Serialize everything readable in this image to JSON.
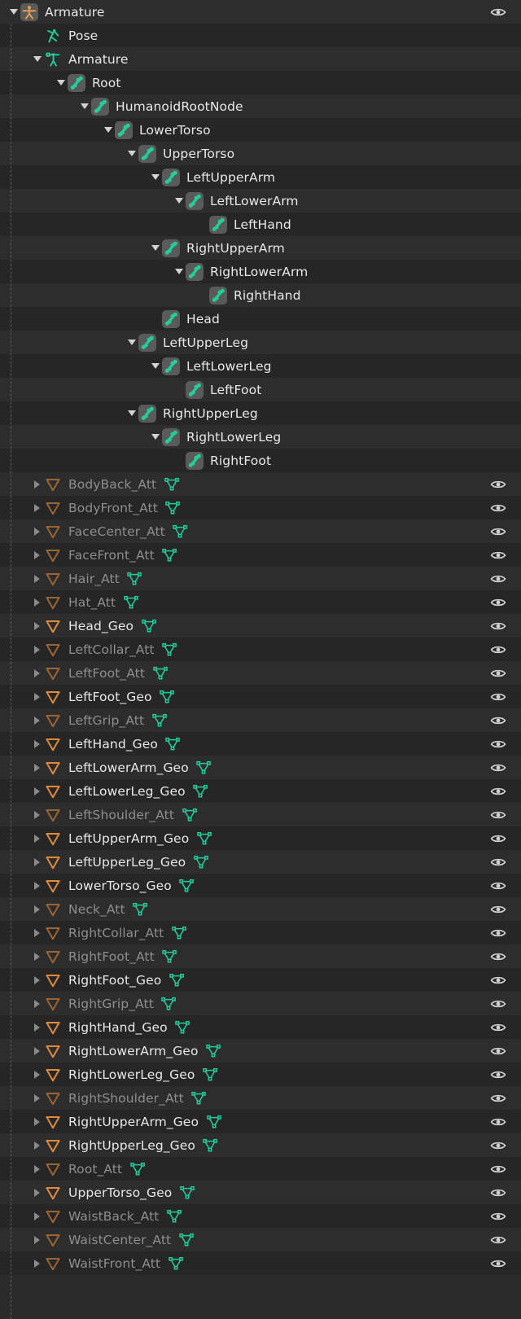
{
  "app": {
    "panel": "blender-outliner",
    "colors": {
      "background": "#2b2b2b",
      "row_alt_light": "#2d2d2d",
      "row_alt_dark": "#262626",
      "text_bright": "#e8e8e8",
      "text_dim": "#8e8e8e",
      "bone_green": "#21cf9a",
      "mesh_orange": "#e08a3c",
      "mesh_orange_dim": "#9b6434",
      "armature_orange": "#e09a54",
      "eye_color": "#d0d0d0"
    }
  },
  "rows": [
    {
      "indent": 0,
      "disclosure": "open",
      "icon": "armature-object-icon",
      "label": "Armature",
      "state": "bright",
      "data_icon": "none",
      "eye": true
    },
    {
      "indent": 1,
      "disclosure": "none",
      "icon": "pose-icon",
      "label": "Pose",
      "state": "bright",
      "data_icon": "none",
      "eye": false
    },
    {
      "indent": 1,
      "disclosure": "open",
      "icon": "armature-data-icon",
      "label": "Armature",
      "state": "bright",
      "data_icon": "none",
      "eye": false
    },
    {
      "indent": 2,
      "disclosure": "open",
      "icon": "bone-icon",
      "label": "Root",
      "state": "bright",
      "data_icon": "none",
      "eye": false
    },
    {
      "indent": 3,
      "disclosure": "open",
      "icon": "bone-icon",
      "label": "HumanoidRootNode",
      "state": "bright",
      "data_icon": "none",
      "eye": false
    },
    {
      "indent": 4,
      "disclosure": "open",
      "icon": "bone-icon",
      "label": "LowerTorso",
      "state": "bright",
      "data_icon": "none",
      "eye": false
    },
    {
      "indent": 5,
      "disclosure": "open",
      "icon": "bone-icon",
      "label": "UpperTorso",
      "state": "bright",
      "data_icon": "none",
      "eye": false
    },
    {
      "indent": 6,
      "disclosure": "open",
      "icon": "bone-icon",
      "label": "LeftUpperArm",
      "state": "bright",
      "data_icon": "none",
      "eye": false
    },
    {
      "indent": 7,
      "disclosure": "open",
      "icon": "bone-icon",
      "label": "LeftLowerArm",
      "state": "bright",
      "data_icon": "none",
      "eye": false
    },
    {
      "indent": 8,
      "disclosure": "none",
      "icon": "bone-icon",
      "label": "LeftHand",
      "state": "bright",
      "data_icon": "none",
      "eye": false
    },
    {
      "indent": 6,
      "disclosure": "open",
      "icon": "bone-icon",
      "label": "RightUpperArm",
      "state": "bright",
      "data_icon": "none",
      "eye": false
    },
    {
      "indent": 7,
      "disclosure": "open",
      "icon": "bone-icon",
      "label": "RightLowerArm",
      "state": "bright",
      "data_icon": "none",
      "eye": false
    },
    {
      "indent": 8,
      "disclosure": "none",
      "icon": "bone-icon",
      "label": "RightHand",
      "state": "bright",
      "data_icon": "none",
      "eye": false
    },
    {
      "indent": 6,
      "disclosure": "none",
      "icon": "bone-icon",
      "label": "Head",
      "state": "bright",
      "data_icon": "none",
      "eye": false
    },
    {
      "indent": 5,
      "disclosure": "open",
      "icon": "bone-icon",
      "label": "LeftUpperLeg",
      "state": "bright",
      "data_icon": "none",
      "eye": false
    },
    {
      "indent": 6,
      "disclosure": "open",
      "icon": "bone-icon",
      "label": "LeftLowerLeg",
      "state": "bright",
      "data_icon": "none",
      "eye": false
    },
    {
      "indent": 7,
      "disclosure": "none",
      "icon": "bone-icon",
      "label": "LeftFoot",
      "state": "bright",
      "data_icon": "none",
      "eye": false
    },
    {
      "indent": 5,
      "disclosure": "open",
      "icon": "bone-icon",
      "label": "RightUpperLeg",
      "state": "bright",
      "data_icon": "none",
      "eye": false
    },
    {
      "indent": 6,
      "disclosure": "open",
      "icon": "bone-icon",
      "label": "RightLowerLeg",
      "state": "bright",
      "data_icon": "none",
      "eye": false
    },
    {
      "indent": 7,
      "disclosure": "none",
      "icon": "bone-icon",
      "label": "RightFoot",
      "state": "bright",
      "data_icon": "none",
      "eye": false
    },
    {
      "indent": 1,
      "disclosure": "closed",
      "icon": "mesh-object-icon",
      "label": "BodyBack_Att",
      "state": "dim",
      "data_icon": "mesh-data-icon",
      "eye": true
    },
    {
      "indent": 1,
      "disclosure": "closed",
      "icon": "mesh-object-icon",
      "label": "BodyFront_Att",
      "state": "dim",
      "data_icon": "mesh-data-icon",
      "eye": true
    },
    {
      "indent": 1,
      "disclosure": "closed",
      "icon": "mesh-object-icon",
      "label": "FaceCenter_Att",
      "state": "dim",
      "data_icon": "mesh-data-icon",
      "eye": true
    },
    {
      "indent": 1,
      "disclosure": "closed",
      "icon": "mesh-object-icon",
      "label": "FaceFront_Att",
      "state": "dim",
      "data_icon": "mesh-data-icon",
      "eye": true
    },
    {
      "indent": 1,
      "disclosure": "closed",
      "icon": "mesh-object-icon",
      "label": "Hair_Att",
      "state": "dim",
      "data_icon": "mesh-data-icon",
      "eye": true
    },
    {
      "indent": 1,
      "disclosure": "closed",
      "icon": "mesh-object-icon",
      "label": "Hat_Att",
      "state": "dim",
      "data_icon": "mesh-data-icon",
      "eye": true
    },
    {
      "indent": 1,
      "disclosure": "closed",
      "icon": "mesh-object-icon",
      "label": "Head_Geo",
      "state": "bright",
      "data_icon": "mesh-data-icon",
      "eye": true
    },
    {
      "indent": 1,
      "disclosure": "closed",
      "icon": "mesh-object-icon",
      "label": "LeftCollar_Att",
      "state": "dim",
      "data_icon": "mesh-data-icon",
      "eye": true
    },
    {
      "indent": 1,
      "disclosure": "closed",
      "icon": "mesh-object-icon",
      "label": "LeftFoot_Att",
      "state": "dim",
      "data_icon": "mesh-data-icon",
      "eye": true
    },
    {
      "indent": 1,
      "disclosure": "closed",
      "icon": "mesh-object-icon",
      "label": "LeftFoot_Geo",
      "state": "bright",
      "data_icon": "mesh-data-icon",
      "eye": true
    },
    {
      "indent": 1,
      "disclosure": "closed",
      "icon": "mesh-object-icon",
      "label": "LeftGrip_Att",
      "state": "dim",
      "data_icon": "mesh-data-icon",
      "eye": true
    },
    {
      "indent": 1,
      "disclosure": "closed",
      "icon": "mesh-object-icon",
      "label": "LeftHand_Geo",
      "state": "bright",
      "data_icon": "mesh-data-icon",
      "eye": true
    },
    {
      "indent": 1,
      "disclosure": "closed",
      "icon": "mesh-object-icon",
      "label": "LeftLowerArm_Geo",
      "state": "bright",
      "data_icon": "mesh-data-icon",
      "eye": true
    },
    {
      "indent": 1,
      "disclosure": "closed",
      "icon": "mesh-object-icon",
      "label": "LeftLowerLeg_Geo",
      "state": "bright",
      "data_icon": "mesh-data-icon",
      "eye": true
    },
    {
      "indent": 1,
      "disclosure": "closed",
      "icon": "mesh-object-icon",
      "label": "LeftShoulder_Att",
      "state": "dim",
      "data_icon": "mesh-data-icon",
      "eye": true
    },
    {
      "indent": 1,
      "disclosure": "closed",
      "icon": "mesh-object-icon",
      "label": "LeftUpperArm_Geo",
      "state": "bright",
      "data_icon": "mesh-data-icon",
      "eye": true
    },
    {
      "indent": 1,
      "disclosure": "closed",
      "icon": "mesh-object-icon",
      "label": "LeftUpperLeg_Geo",
      "state": "bright",
      "data_icon": "mesh-data-icon",
      "eye": true
    },
    {
      "indent": 1,
      "disclosure": "closed",
      "icon": "mesh-object-icon",
      "label": "LowerTorso_Geo",
      "state": "bright",
      "data_icon": "mesh-data-icon",
      "eye": true
    },
    {
      "indent": 1,
      "disclosure": "closed",
      "icon": "mesh-object-icon",
      "label": "Neck_Att",
      "state": "dim",
      "data_icon": "mesh-data-icon",
      "eye": true
    },
    {
      "indent": 1,
      "disclosure": "closed",
      "icon": "mesh-object-icon",
      "label": "RightCollar_Att",
      "state": "dim",
      "data_icon": "mesh-data-icon",
      "eye": true
    },
    {
      "indent": 1,
      "disclosure": "closed",
      "icon": "mesh-object-icon",
      "label": "RightFoot_Att",
      "state": "dim",
      "data_icon": "mesh-data-icon",
      "eye": true
    },
    {
      "indent": 1,
      "disclosure": "closed",
      "icon": "mesh-object-icon",
      "label": "RightFoot_Geo",
      "state": "bright",
      "data_icon": "mesh-data-icon",
      "eye": true
    },
    {
      "indent": 1,
      "disclosure": "closed",
      "icon": "mesh-object-icon",
      "label": "RightGrip_Att",
      "state": "dim",
      "data_icon": "mesh-data-icon",
      "eye": true
    },
    {
      "indent": 1,
      "disclosure": "closed",
      "icon": "mesh-object-icon",
      "label": "RightHand_Geo",
      "state": "bright",
      "data_icon": "mesh-data-icon",
      "eye": true
    },
    {
      "indent": 1,
      "disclosure": "closed",
      "icon": "mesh-object-icon",
      "label": "RightLowerArm_Geo",
      "state": "bright",
      "data_icon": "mesh-data-icon",
      "eye": true
    },
    {
      "indent": 1,
      "disclosure": "closed",
      "icon": "mesh-object-icon",
      "label": "RightLowerLeg_Geo",
      "state": "bright",
      "data_icon": "mesh-data-icon",
      "eye": true
    },
    {
      "indent": 1,
      "disclosure": "closed",
      "icon": "mesh-object-icon",
      "label": "RightShoulder_Att",
      "state": "dim",
      "data_icon": "mesh-data-icon",
      "eye": true
    },
    {
      "indent": 1,
      "disclosure": "closed",
      "icon": "mesh-object-icon",
      "label": "RightUpperArm_Geo",
      "state": "bright",
      "data_icon": "mesh-data-icon",
      "eye": true
    },
    {
      "indent": 1,
      "disclosure": "closed",
      "icon": "mesh-object-icon",
      "label": "RightUpperLeg_Geo",
      "state": "bright",
      "data_icon": "mesh-data-icon",
      "eye": true
    },
    {
      "indent": 1,
      "disclosure": "closed",
      "icon": "mesh-object-icon",
      "label": "Root_Att",
      "state": "dim",
      "data_icon": "mesh-data-icon",
      "eye": true
    },
    {
      "indent": 1,
      "disclosure": "closed",
      "icon": "mesh-object-icon",
      "label": "UpperTorso_Geo",
      "state": "bright",
      "data_icon": "mesh-data-icon",
      "eye": true
    },
    {
      "indent": 1,
      "disclosure": "closed",
      "icon": "mesh-object-icon",
      "label": "WaistBack_Att",
      "state": "dim",
      "data_icon": "mesh-data-icon",
      "eye": true
    },
    {
      "indent": 1,
      "disclosure": "closed",
      "icon": "mesh-object-icon",
      "label": "WaistCenter_Att",
      "state": "dim",
      "data_icon": "mesh-data-icon",
      "eye": true
    },
    {
      "indent": 1,
      "disclosure": "closed",
      "icon": "mesh-object-icon",
      "label": "WaistFront_Att",
      "state": "dim",
      "data_icon": "mesh-data-icon",
      "eye": true
    }
  ]
}
